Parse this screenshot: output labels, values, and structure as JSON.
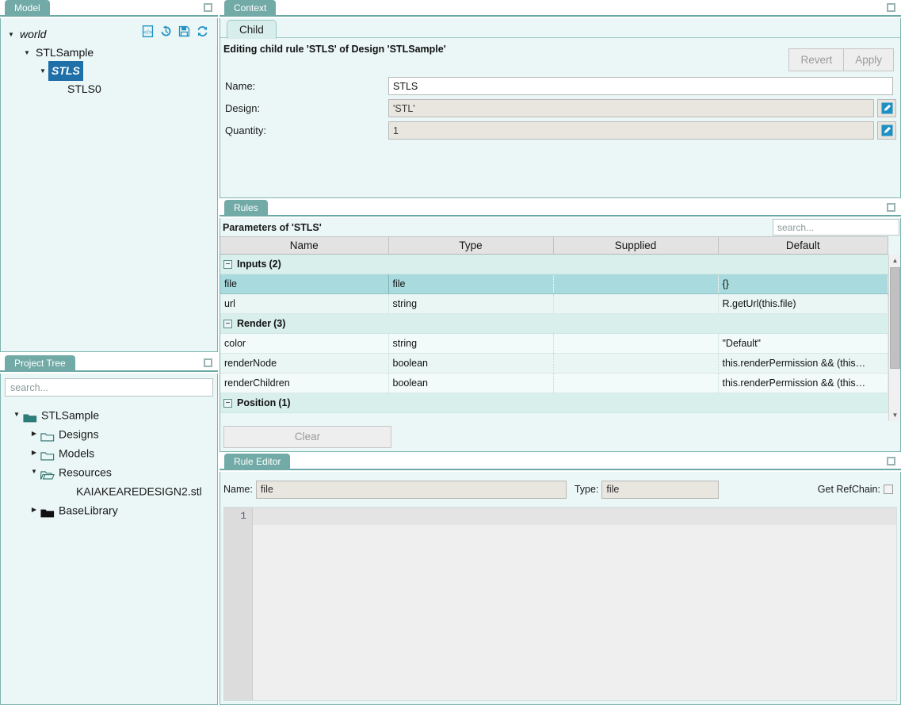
{
  "model_panel": {
    "title": "Model",
    "maximize_icon": "maximize-icon",
    "toolbar_icons": [
      "code-icon",
      "history-undo-icon",
      "save-icon",
      "refresh-icon"
    ],
    "tree": [
      {
        "label": "world",
        "depth": 0,
        "caret": "down",
        "italic": true,
        "selected": false
      },
      {
        "label": "STLSample",
        "depth": 1,
        "caret": "down",
        "italic": false,
        "selected": false
      },
      {
        "label": "STLS",
        "depth": 2,
        "caret": "down",
        "italic": true,
        "selected": true
      },
      {
        "label": "STLS0",
        "depth": 3,
        "caret": "none",
        "italic": false,
        "selected": false
      }
    ]
  },
  "project_panel": {
    "title": "Project Tree",
    "maximize_icon": "maximize-icon",
    "search_placeholder": "search...",
    "tree": [
      {
        "label": "STLSample",
        "depth": 0,
        "caret": "down",
        "folder": "open-folder"
      },
      {
        "label": "Designs",
        "depth": 1,
        "caret": "right",
        "folder": "closed-folder"
      },
      {
        "label": "Models",
        "depth": 1,
        "caret": "right",
        "folder": "closed-folder"
      },
      {
        "label": "Resources",
        "depth": 1,
        "caret": "down",
        "folder": "open-folder-outline"
      },
      {
        "label": "KAIAKEAREDESIGN2.stl",
        "depth": 2,
        "caret": "none",
        "folder": "none"
      },
      {
        "label": "BaseLibrary",
        "depth": 1,
        "caret": "right",
        "folder": "filled-folder"
      }
    ]
  },
  "context_panel": {
    "title": "Context",
    "maximize_icon": "maximize-icon",
    "tab": "Child",
    "headline": "Editing child rule 'STLS' of Design 'STLSample'",
    "revert_label": "Revert",
    "apply_label": "Apply",
    "fields": [
      {
        "label": "Name:",
        "value": "STLS",
        "readonly": false,
        "edit_button": false
      },
      {
        "label": "Design:",
        "value": "'STL'",
        "readonly": true,
        "edit_button": true
      },
      {
        "label": "Quantity:",
        "value": "1",
        "readonly": true,
        "edit_button": true
      }
    ]
  },
  "rules_panel": {
    "title": "Rules",
    "maximize_icon": "maximize-icon",
    "subtitle": "Parameters of 'STLS'",
    "search_placeholder": "search...",
    "columns": [
      "Name",
      "Type",
      "Supplied",
      "Default"
    ],
    "rows": [
      {
        "kind": "group",
        "label": "Inputs",
        "count": "(2)"
      },
      {
        "kind": "row",
        "selected": true,
        "name": "file",
        "type": "file",
        "supplied": "",
        "default": "{}"
      },
      {
        "kind": "row",
        "selected": false,
        "name": "url",
        "type": "string",
        "supplied": "",
        "default": "R.getUrl(this.file)"
      },
      {
        "kind": "group",
        "label": "Render",
        "count": "(3)"
      },
      {
        "kind": "row",
        "selected": false,
        "name": "color",
        "type": "string",
        "supplied": "",
        "default": "\"Default\""
      },
      {
        "kind": "row",
        "selected": false,
        "name": "renderNode",
        "type": "boolean",
        "supplied": "",
        "default": "this.renderPermission && (this…"
      },
      {
        "kind": "row",
        "selected": false,
        "name": "renderChildren",
        "type": "boolean",
        "supplied": "",
        "default": "this.renderPermission && (this…"
      },
      {
        "kind": "group",
        "label": "Position",
        "count": "(1)"
      }
    ],
    "clear_label": "Clear"
  },
  "editor_panel": {
    "title": "Rule Editor",
    "maximize_icon": "maximize-icon",
    "name_label": "Name:",
    "name_value": "file",
    "type_label": "Type:",
    "type_value": "file",
    "refchain_label": "Get RefChain:",
    "refchain_checked": false,
    "line_numbers": [
      "1"
    ],
    "code_lines": [
      ""
    ]
  },
  "colors": {
    "tab_teal": "#71aaa6",
    "panel_bg": "#eaf7f6",
    "selection_blue": "#1f6fa8",
    "row_selected": "#a9dbde",
    "group_bg": "#d9efec",
    "edit_icon_blue": "#1f90c4"
  }
}
